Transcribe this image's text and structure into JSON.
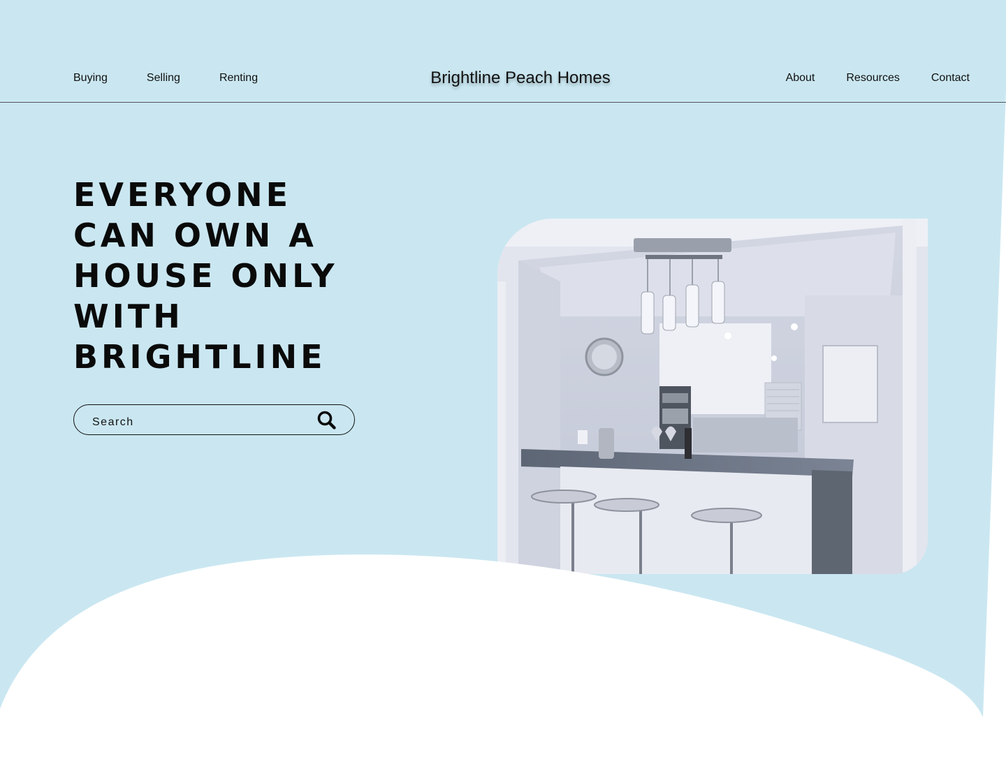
{
  "colors": {
    "background": "#cae7f1",
    "text": "#0a0a0a",
    "wave": "#ffffff"
  },
  "nav": {
    "left": [
      {
        "label": "Buying"
      },
      {
        "label": "Selling"
      },
      {
        "label": "Renting"
      }
    ],
    "brand": "Brightline Peach Homes",
    "right": [
      {
        "label": "About"
      },
      {
        "label": "Resources"
      },
      {
        "label": "Contact"
      }
    ]
  },
  "hero": {
    "title_lines": [
      "EVERYONE",
      "CAN OWN A",
      "HOUSE ONLY",
      "WITH",
      "BRIGHTLINE"
    ],
    "search": {
      "placeholder": "Search",
      "icon": "search-icon"
    },
    "image": {
      "icon": "kitchen-photo"
    }
  }
}
